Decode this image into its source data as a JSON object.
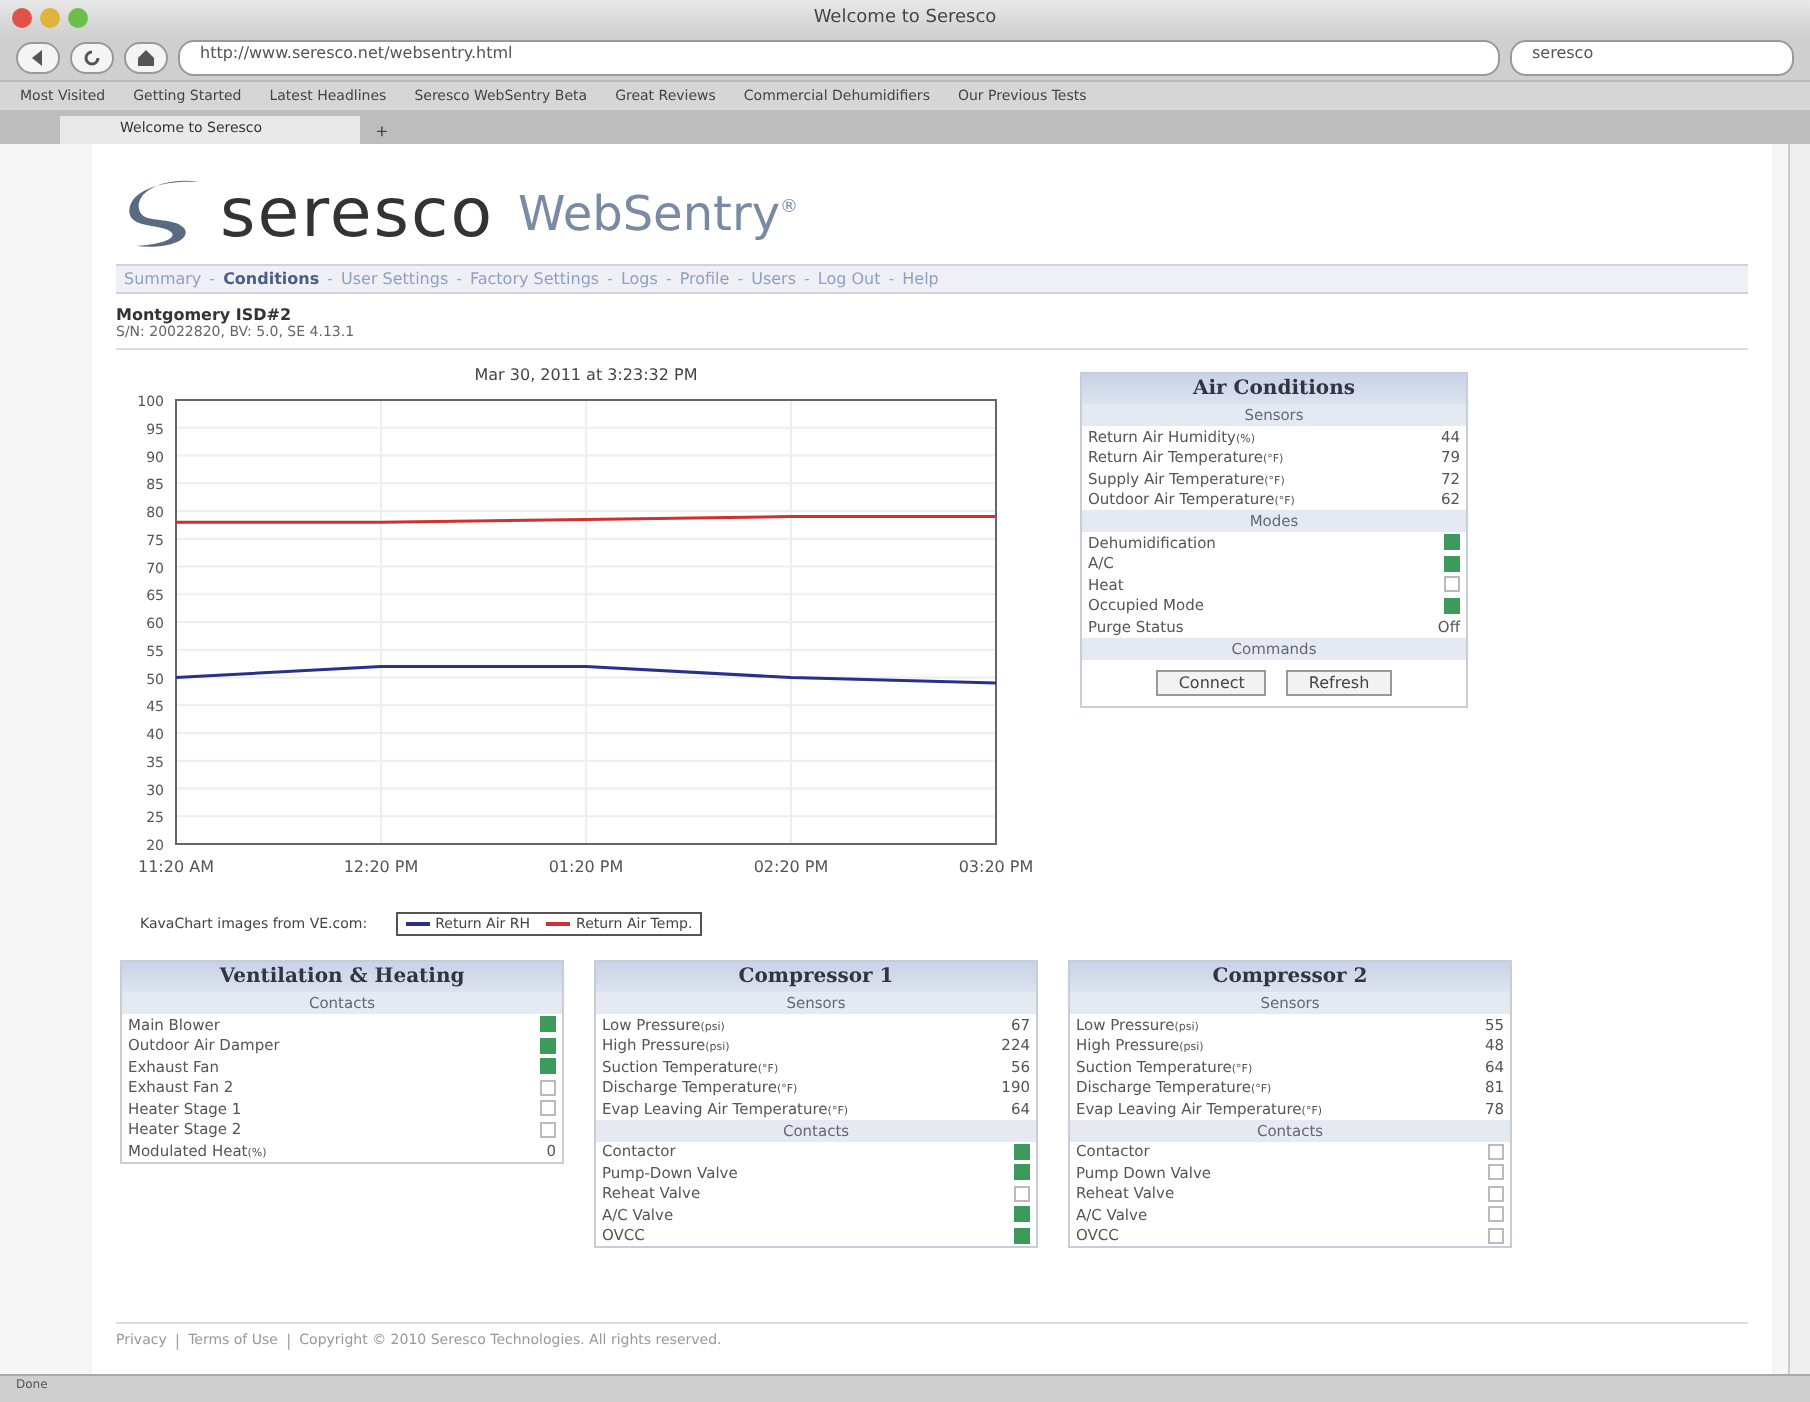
{
  "window": {
    "title": "Welcome to Seresco"
  },
  "toolbar": {
    "url": "http://www.seresco.net/websentry.html",
    "search": "seresco"
  },
  "bookmarks": [
    "Most Visited",
    "Getting Started",
    "Latest Headlines",
    "Seresco WebSentry Beta",
    "Great Reviews",
    "Commercial Dehumidifiers",
    "Our Previous Tests"
  ],
  "tabs": [
    {
      "label": "Welcome to Seresco",
      "selected": true
    }
  ],
  "new_tab": "+",
  "brand": {
    "name": "seresco",
    "product": "WebSentry",
    "mark": "®"
  },
  "nav": [
    {
      "label": "Summary",
      "selected": false
    },
    {
      "label": "Conditions",
      "selected": true
    },
    {
      "label": "User Settings",
      "selected": false
    },
    {
      "label": "Factory Settings",
      "selected": false
    },
    {
      "label": "Logs",
      "selected": false
    },
    {
      "label": "Profile",
      "selected": false
    },
    {
      "label": "Users",
      "selected": false
    },
    {
      "label": "Log Out",
      "selected": false
    },
    {
      "label": "Help",
      "selected": false
    }
  ],
  "nav_separator": "-",
  "unit": {
    "name": "Montgomery ISD#2",
    "serial": "S/N: 20022820, BV: 5.0, SE 4.13.1"
  },
  "chart": {
    "credit": "KavaChart images from VE.com:",
    "chart_data": {
      "type": "line",
      "grid": true,
      "title": "Mar 30, 2011 at 3:23:32 PM",
      "categories": [
        "11:20 AM",
        "12:20 PM",
        "01:20 PM",
        "02:20 PM",
        "03:20 PM"
      ],
      "ylim": [
        20,
        100
      ],
      "yticks": [
        20,
        25,
        30,
        35,
        40,
        45,
        50,
        55,
        60,
        65,
        70,
        75,
        80,
        85,
        90,
        95,
        100
      ],
      "series": [
        {
          "name": "Return Air RH",
          "color": "#2b2f8c",
          "values": [
            50,
            52,
            52,
            50,
            49
          ]
        },
        {
          "name": "Return Air Temp.",
          "color": "#d03030",
          "values": [
            78,
            78,
            78.5,
            79,
            79
          ]
        }
      ]
    }
  },
  "panels": [
    {
      "title": "Air Conditions",
      "sections": [
        {
          "title": "Sensors",
          "rows": [
            {
              "kind": "value",
              "label": "Return Air Humidity",
              "unit": "(%)",
              "value": "44"
            },
            {
              "kind": "value",
              "label": "Return Air Temperature",
              "unit": "(°F)",
              "value": "79"
            },
            {
              "kind": "value",
              "label": "Supply Air Temperature",
              "unit": "(°F)",
              "value": "72"
            },
            {
              "kind": "value",
              "label": "Outdoor Air Temperature",
              "unit": "(°F)",
              "value": "62"
            }
          ]
        },
        {
          "title": "Modes",
          "rows": [
            {
              "kind": "contact",
              "label": "Dehumidification",
              "on": true
            },
            {
              "kind": "contact",
              "label": "A/C",
              "on": true
            },
            {
              "kind": "contact",
              "label": "Heat",
              "on": false
            },
            {
              "kind": "contact",
              "label": "Occupied Mode",
              "on": true
            },
            {
              "kind": "value",
              "label": "Purge Status",
              "value": "Off"
            }
          ]
        },
        {
          "title": "Commands",
          "buttons": [
            "Connect",
            "Refresh"
          ]
        }
      ]
    },
    {
      "title": "Ventilation & Heating",
      "sections": [
        {
          "title": "Contacts",
          "rows": [
            {
              "kind": "contact",
              "label": "Main Blower",
              "on": true
            },
            {
              "kind": "contact",
              "label": "Outdoor Air Damper",
              "on": true
            },
            {
              "kind": "contact",
              "label": "Exhaust Fan",
              "on": true
            },
            {
              "kind": "contact",
              "label": "Exhaust Fan 2",
              "on": false
            },
            {
              "kind": "contact",
              "label": "Heater Stage 1",
              "on": false
            },
            {
              "kind": "contact",
              "label": "Heater Stage 2",
              "on": false
            },
            {
              "kind": "value",
              "label": "Modulated Heat",
              "unit": "(%)",
              "value": "0"
            }
          ]
        }
      ]
    },
    {
      "title": "Compressor 1",
      "sections": [
        {
          "title": "Sensors",
          "rows": [
            {
              "kind": "value",
              "label": "Low Pressure",
              "unit": "(psi)",
              "value": "67"
            },
            {
              "kind": "value",
              "label": "High Pressure",
              "unit": "(psi)",
              "value": "224"
            },
            {
              "kind": "value",
              "label": "Suction Temperature",
              "unit": "(°F)",
              "value": "56"
            },
            {
              "kind": "value",
              "label": "Discharge Temperature",
              "unit": "(°F)",
              "value": "190"
            },
            {
              "kind": "value",
              "label": "Evap Leaving Air Temperature",
              "unit": "(°F)",
              "value": "64"
            }
          ]
        },
        {
          "title": "Contacts",
          "rows": [
            {
              "kind": "contact",
              "label": "Contactor",
              "on": true
            },
            {
              "kind": "contact",
              "label": "Pump-Down Valve",
              "on": true
            },
            {
              "kind": "contact",
              "label": "Reheat Valve",
              "on": false
            },
            {
              "kind": "contact",
              "label": "A/C Valve",
              "on": true
            },
            {
              "kind": "contact",
              "label": "OVCC",
              "on": true
            }
          ]
        }
      ]
    },
    {
      "title": "Compressor 2",
      "sections": [
        {
          "title": "Sensors",
          "rows": [
            {
              "kind": "value",
              "label": "Low Pressure",
              "unit": "(psi)",
              "value": "55"
            },
            {
              "kind": "value",
              "label": "High Pressure",
              "unit": "(psi)",
              "value": "48"
            },
            {
              "kind": "value",
              "label": "Suction Temperature",
              "unit": "(°F)",
              "value": "64"
            },
            {
              "kind": "value",
              "label": "Discharge Temperature",
              "unit": "(°F)",
              "value": "81"
            },
            {
              "kind": "value",
              "label": "Evap Leaving Air Temperature",
              "unit": "(°F)",
              "value": "78"
            }
          ]
        },
        {
          "title": "Contacts",
          "rows": [
            {
              "kind": "contact",
              "label": "Contactor",
              "on": false
            },
            {
              "kind": "contact",
              "label": "Pump Down Valve",
              "on": false
            },
            {
              "kind": "contact",
              "label": "Reheat Valve",
              "on": false
            },
            {
              "kind": "contact",
              "label": "A/C Valve",
              "on": false
            },
            {
              "kind": "contact",
              "label": "OVCC",
              "on": false
            }
          ]
        }
      ]
    }
  ],
  "footer_separator": "|",
  "footer": [
    "Privacy",
    "Terms of Use",
    "Copyright © 2010 Seresco Technologies. All rights reserved."
  ],
  "status_bar": "Done"
}
